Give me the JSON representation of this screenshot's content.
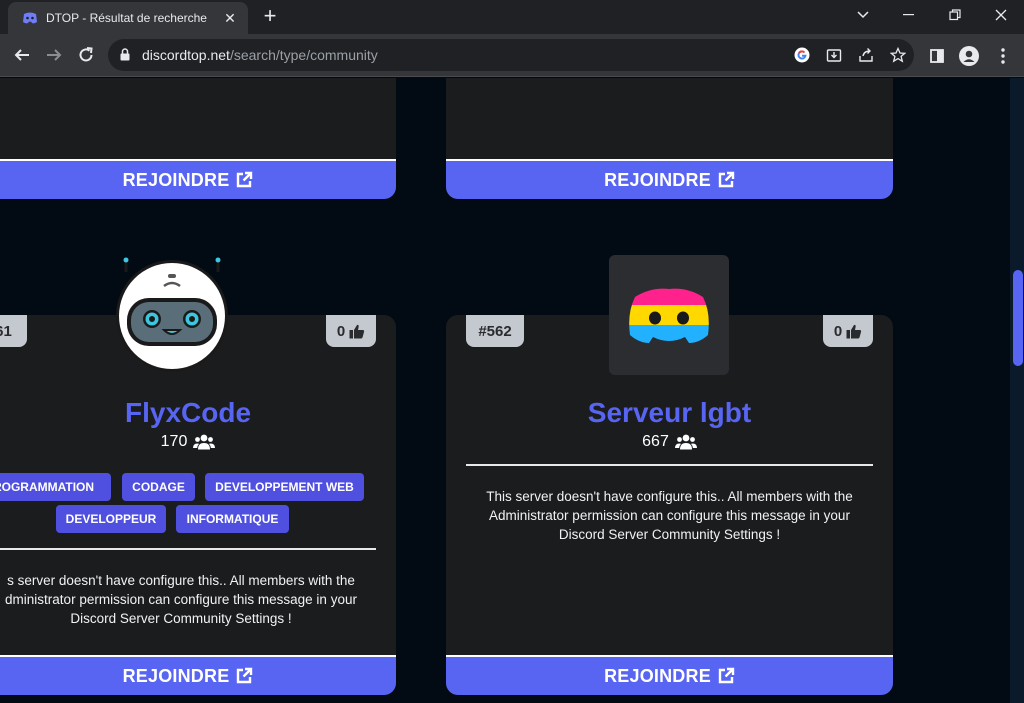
{
  "browser": {
    "tab_title": "DTOP - Résultat de recherche",
    "url_domain": "discordtop.net",
    "url_path": "/search/type/community"
  },
  "cards": [
    {
      "id": "top-left",
      "join_label": "REJOINDRE"
    },
    {
      "id": "top-right",
      "join_label": "REJOINDRE"
    },
    {
      "id": "flyxcode",
      "rank": "61",
      "likes": "0",
      "name": "FlyxCode",
      "members": "170",
      "tags": [
        "ROGRAMMATION",
        "CODAGE",
        "DEVELOPPEMENT WEB",
        "DEVELOPPEUR",
        "INFORMATIQUE"
      ],
      "description": "s server doesn't have configure this.. All members with the dministrator permission can configure this message in your Discord Server Community Settings !",
      "join_label": "REJOINDRE"
    },
    {
      "id": "serveur-lgbt",
      "rank": "#562",
      "likes": "0",
      "name": "Serveur lgbt",
      "members": "667",
      "tags": [],
      "description": "This server doesn't have configure this.. All members with the Administrator permission can configure this message in your Discord Server Community Settings !",
      "join_label": "REJOINDRE"
    }
  ],
  "colors": {
    "accent": "#5865f2",
    "card_bg": "#1b1c1e",
    "page_bg": "#020b13",
    "tag_bg": "#4f4fe0",
    "badge_bg": "#c4c8cf"
  },
  "icons": {
    "join": "external-link-icon",
    "members": "users-icon",
    "likes": "thumbs-up-icon"
  }
}
